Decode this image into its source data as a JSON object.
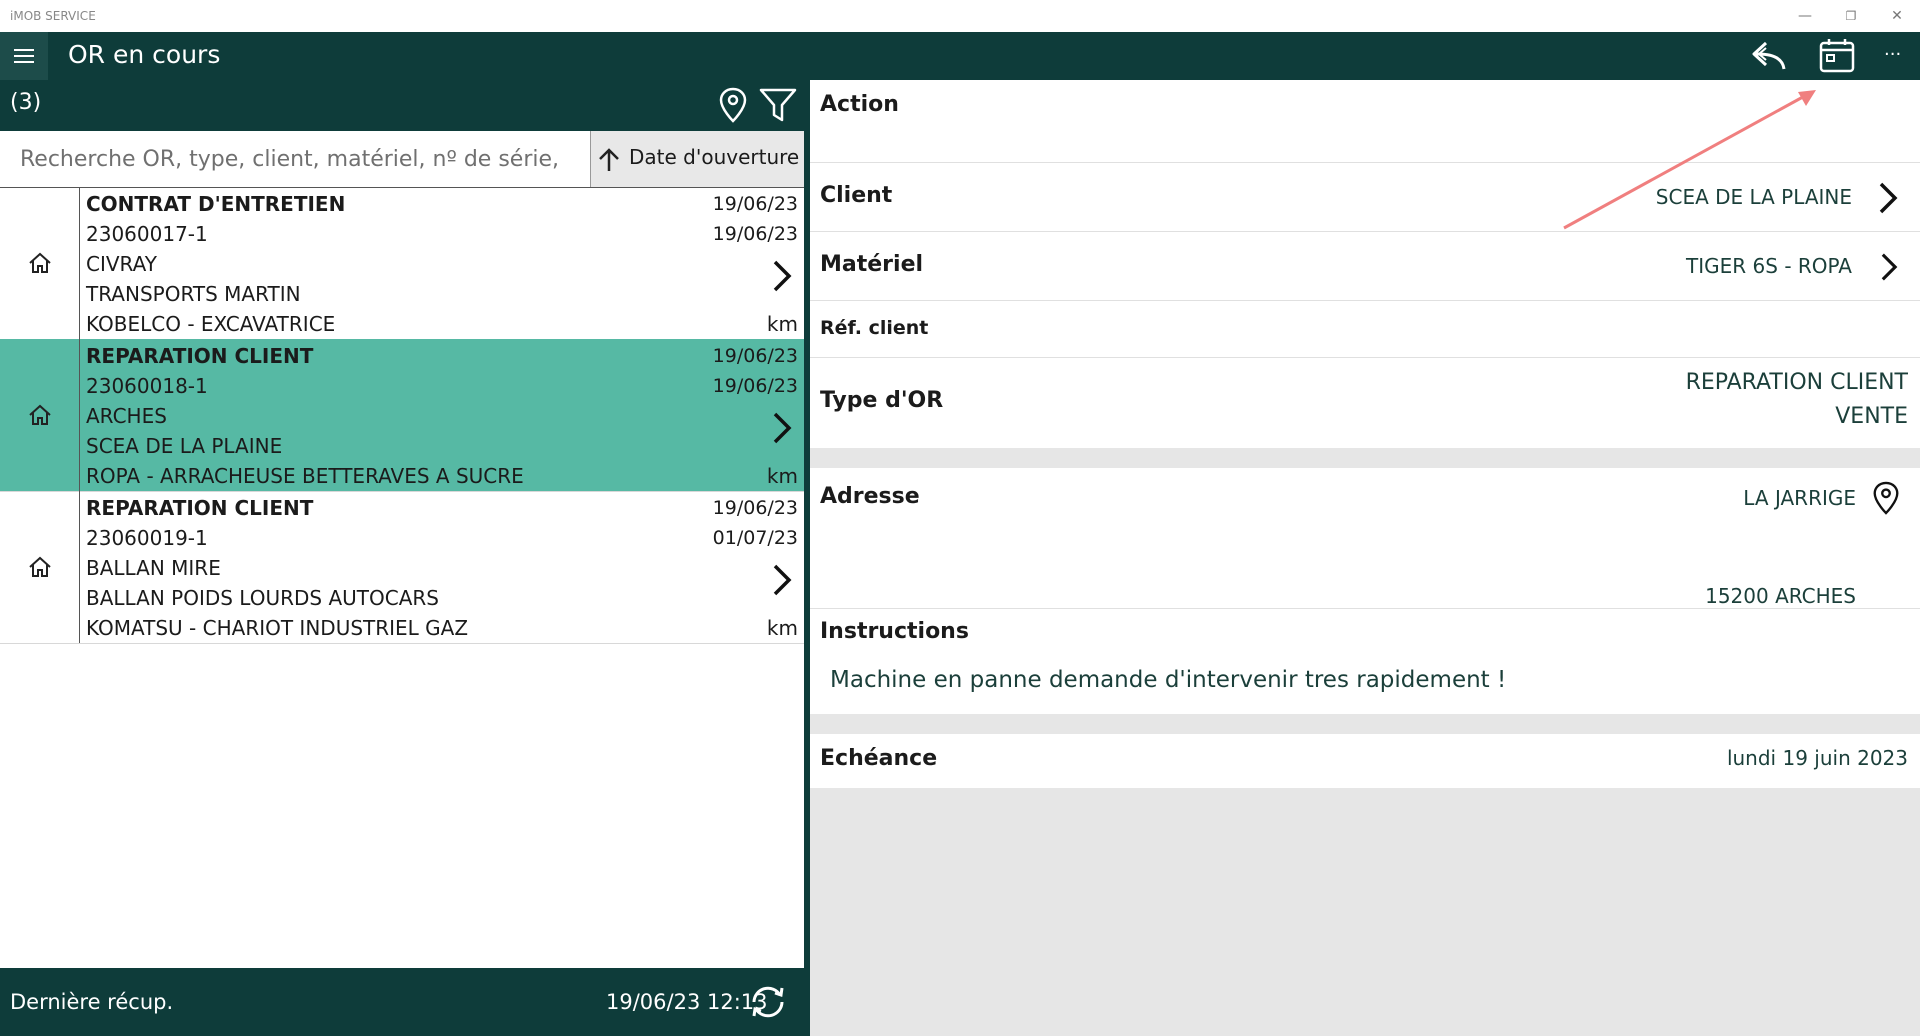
{
  "window": {
    "app_title": "iMOB SERVICE",
    "controls": [
      "—",
      "❐",
      "✕"
    ]
  },
  "appbar": {
    "title": "OR en cours",
    "icons": [
      "menu-icon",
      "reply-icon",
      "calendar-icon",
      "more-icon"
    ],
    "more_label": "···"
  },
  "list": {
    "count": "(3)",
    "search_placeholder": "Recherche OR, type, client, matériel, nº de série,",
    "search_value": "",
    "sort_label": "Date d'ouverture",
    "items": [
      {
        "type": "CONTRAT D'ENTRETIEN",
        "number": "23060017-1",
        "city": "CIVRAY",
        "client": "TRANSPORTS MARTIN",
        "equipment": "KOBELCO - EXCAVATRICE",
        "date1": "19/06/23",
        "date2": "19/06/23",
        "unit": "km",
        "selected": false
      },
      {
        "type": "REPARATION CLIENT",
        "number": "23060018-1",
        "city": "ARCHES",
        "client": "SCEA DE LA PLAINE",
        "equipment": "ROPA - ARRACHEUSE BETTERAVES A SUCRE",
        "date1": "19/06/23",
        "date2": "19/06/23",
        "unit": "km",
        "selected": true
      },
      {
        "type": "REPARATION CLIENT",
        "number": "23060019-1",
        "city": "BALLAN MIRE",
        "client": "BALLAN POIDS LOURDS AUTOCARS",
        "equipment": "KOMATSU - CHARIOT INDUSTRIEL GAZ",
        "date1": "19/06/23",
        "date2": "01/07/23",
        "unit": "km",
        "selected": false
      }
    ],
    "footer": {
      "label": "Dernière récup.",
      "datetime": "19/06/23 12:13"
    }
  },
  "detail": {
    "action": {
      "label": "Action"
    },
    "client": {
      "label": "Client",
      "value": "SCEA DE LA PLAINE"
    },
    "materiel": {
      "label": "Matériel",
      "value": "TIGER 6S - ROPA"
    },
    "ref_client": {
      "label": "Réf. client",
      "value": ""
    },
    "type_or": {
      "label": "Type d'OR",
      "value1": "REPARATION CLIENT",
      "value2": "VENTE"
    },
    "adresse": {
      "label": "Adresse",
      "line1": "LA JARRIGE",
      "line2": "15200 ARCHES"
    },
    "instructions": {
      "label": "Instructions",
      "text": "Machine en panne  demande d'intervenir tres rapidement !"
    },
    "echeance": {
      "label": "Echéance",
      "value": "lundi 19 juin 2023"
    }
  },
  "colors": {
    "primary_dark": "#0e3c3a",
    "selected_row": "#56b9a4",
    "annotation_arrow": "#f07f7f"
  }
}
